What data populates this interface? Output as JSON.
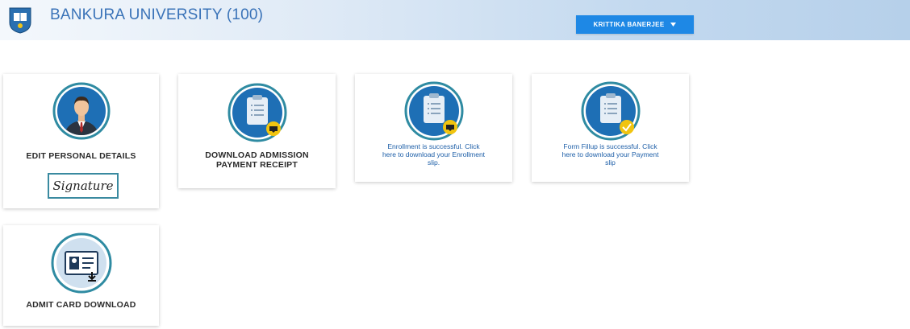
{
  "header": {
    "title": "BANKURA UNIVERSITY (100)",
    "user_name": "KRITTIKA BANERJEE",
    "user_dropdown_icon": "caret-down-icon"
  },
  "cards": {
    "edit_personal": {
      "label": "EDIT PERSONAL DETAILS",
      "signature": "Signature",
      "icon": "user-avatar-icon"
    },
    "admission_receipt": {
      "label_line1": "DOWNLOAD ADMISSION",
      "label_line2": "PAYMENT RECEIPT",
      "icon": "clipboard-download-icon"
    },
    "enrollment": {
      "line1": "Enrollment is successful. Click",
      "line2": "here to download your Enrollment",
      "line3": "slip.",
      "icon": "clipboard-download-icon"
    },
    "form_fillup": {
      "line1": "Form Fillup is successful. Click",
      "line2": "here to download your Payment",
      "line3": "slip",
      "icon": "clipboard-check-icon"
    },
    "admit_card": {
      "label": "ADMIT CARD DOWNLOAD",
      "icon": "id-card-download-icon"
    }
  },
  "colors": {
    "accent": "#1e88e5",
    "title": "#3a73b8",
    "icon_blue": "#1e6fb5",
    "icon_ring": "#2f8ba2",
    "badge_yellow": "#f1c40f"
  }
}
